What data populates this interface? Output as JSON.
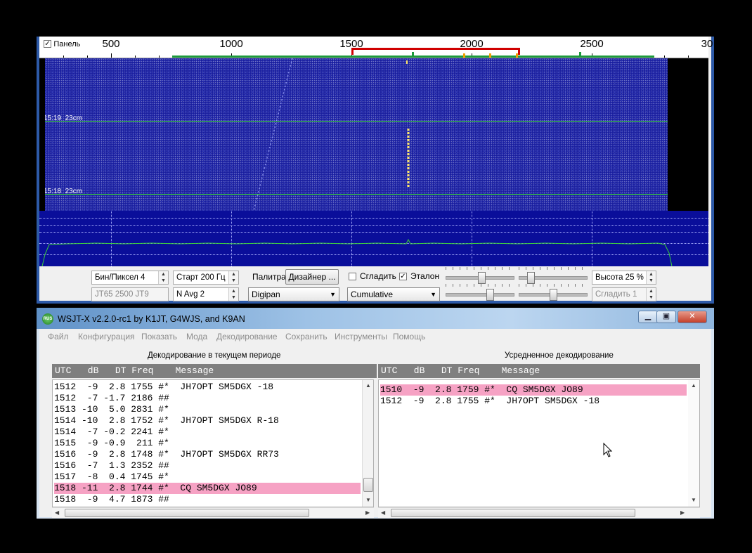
{
  "wide_graph": {
    "panel_label": "Панель",
    "panel_checked": true,
    "freq_ticks": [
      "500",
      "1000",
      "1500",
      "2000",
      "2500",
      "30"
    ],
    "waterfall_labels": [
      {
        "time": "15:19",
        "band": "23cm"
      },
      {
        "time": "15:18",
        "band": "23cm"
      }
    ],
    "controls": {
      "bins_per_pixel": "Бин/Пиксел  4",
      "start": "Старт 200 Гц",
      "mode_info": "JT65  2500  JT9",
      "n_avg": "N Avg 2",
      "palette_label": "Палитра",
      "designer_button": "Дизайнер ...",
      "palette_select": "Digipan",
      "smooth_label": "Сгладить",
      "smooth_checked": false,
      "reference_label": "Эталон",
      "reference_checked": true,
      "spectrum_select": "Cumulative",
      "height": "Высота 25 %",
      "smooth_value": "Сгладить   1"
    },
    "colors": {
      "waterfall": "#1a1fa0",
      "spectrum_trace": "#3ad13a",
      "tx_marker": "#d00000"
    }
  },
  "main_window": {
    "title": "WSJT-X   v2.2.0-rc1   by K1JT, G4WJS, and K9AN",
    "app_icon_text": "RUS",
    "window_buttons": {
      "minimize": "▁",
      "maximize": "▣",
      "close": "✕"
    },
    "menu": [
      "Файл",
      "Конфигурация",
      "Показать",
      "Мода",
      "Декодирование",
      "Сохранить",
      "Инструменты",
      "Помощь"
    ],
    "band_activity": {
      "title": "Декодирование в текущем периоде",
      "header": "UTC   dB   DT Freq    Message",
      "rows": [
        {
          "text": "1512  -9  2.8 1755 #*  JH7OPT SM5DGX -18",
          "highlight": false
        },
        {
          "text": "1512  -7 -1.7 2186 ##",
          "highlight": false
        },
        {
          "text": "1513 -10  5.0 2831 #*",
          "highlight": false
        },
        {
          "text": "1514 -10  2.8 1752 #*  JH7OPT SM5DGX R-18",
          "highlight": false
        },
        {
          "text": "1514  -7 -0.2 2241 #*",
          "highlight": false
        },
        {
          "text": "1515  -9 -0.9  211 #*",
          "highlight": false
        },
        {
          "text": "1516  -9  2.8 1748 #*  JH7OPT SM5DGX RR73",
          "highlight": false
        },
        {
          "text": "1516  -7  1.3 2352 ##",
          "highlight": false
        },
        {
          "text": "1517  -8  0.4 1745 #*",
          "highlight": false
        },
        {
          "text": "1518 -11  2.8 1744 #*  CQ SM5DGX JO89",
          "highlight": true
        },
        {
          "text": "1518  -9  4.7 1873 ##",
          "highlight": false
        }
      ]
    },
    "averaged": {
      "title": "Усредненное декодирование",
      "header": "UTC   dB   DT Freq    Message",
      "rows": [
        {
          "text": "1510  -9  2.8 1759 #*  CQ SM5DGX JO89",
          "highlight": true
        },
        {
          "text": "1512  -9  2.8 1755 #*  JH7OPT SM5DGX -18",
          "highlight": false
        }
      ]
    },
    "colors": {
      "highlight": "#f6a2c4",
      "header_bg": "#7f7f7f"
    }
  }
}
